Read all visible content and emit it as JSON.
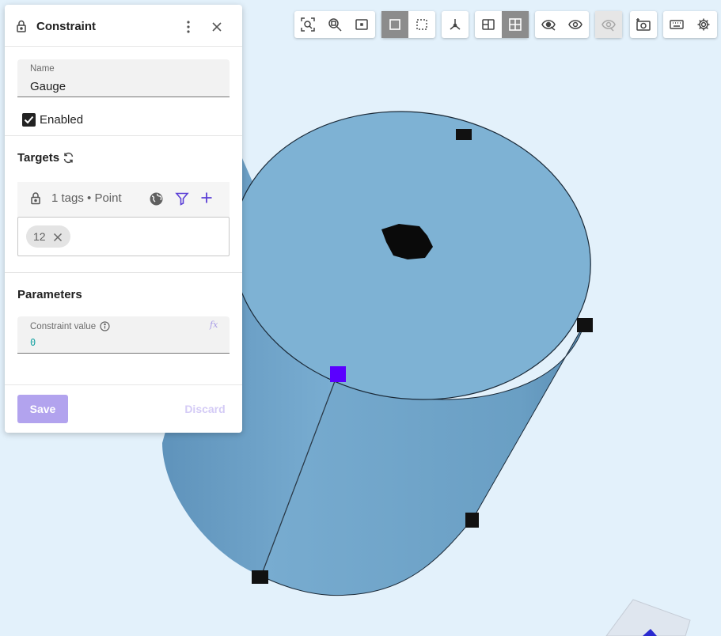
{
  "panel": {
    "title": "Constraint",
    "name_field": {
      "label": "Name",
      "value": "Gauge"
    },
    "enabled": {
      "label": "Enabled",
      "checked": true
    },
    "targets": {
      "title": "Targets",
      "summary": "1 tags • Point",
      "tags": [
        "12"
      ]
    },
    "parameters": {
      "title": "Parameters",
      "constraint_value": {
        "label": "Constraint value",
        "value": "0",
        "fx": "fx"
      }
    },
    "save_label": "Save",
    "discard_label": "Discard"
  },
  "toolbar": {
    "groups": [
      [
        "zoom-to-fit-icon",
        "zoom-icon",
        "frame-icon"
      ],
      [
        "solid-view-icon",
        "wireframe-view-icon"
      ],
      [
        "axes-icon"
      ],
      [
        "section-view-icon",
        "grid-icon"
      ],
      [
        "hide-icon",
        "show-icon"
      ],
      [
        "visibility-disabled-icon"
      ],
      [
        "screenshot-icon"
      ],
      [
        "keyboard-icon",
        "gear-icon"
      ]
    ]
  },
  "colors": {
    "accent": "#5b3fd6",
    "cylinder": "#7eb2d4",
    "background": "#e3f1fb",
    "selected_point": "#5a00ff"
  }
}
